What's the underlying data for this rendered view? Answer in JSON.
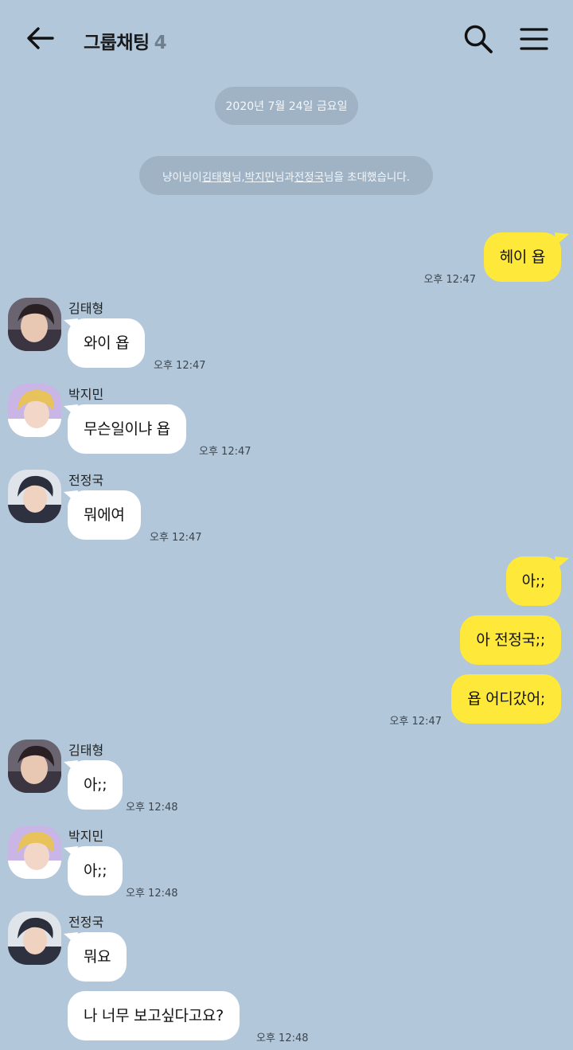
{
  "header": {
    "title": "그룹채팅",
    "member_count": "4",
    "back_icon": "arrow-left-icon",
    "search_icon": "search-icon",
    "menu_icon": "menu-icon"
  },
  "system": {
    "date": "2020년 7월 24일 금요일",
    "invite": {
      "pre": "냥이님이 ",
      "name1": "김태형",
      "mid1": "님, ",
      "name2": "박지민",
      "mid2": "님과 ",
      "name3": "전정국",
      "post": "님을 초대했습니다."
    }
  },
  "colors": {
    "background": "#b2c7da",
    "my_bubble": "#fee93a",
    "other_bubble": "#ffffff",
    "system_pill": "#a0b3c5"
  },
  "messages": [
    {
      "side": "me",
      "text": "헤이 욥",
      "time": "오후 12:47"
    },
    {
      "side": "other",
      "sender": "김태형",
      "text": "와이 욥",
      "time": "오후 12:47"
    },
    {
      "side": "other",
      "sender": "박지민",
      "text": "무슨일이냐 욥",
      "time": "오후 12:47"
    },
    {
      "side": "other",
      "sender": "전정국",
      "text": "뭐에여",
      "time": "오후 12:47"
    },
    {
      "side": "me",
      "text": "아;;",
      "time": ""
    },
    {
      "side": "me",
      "text": "아 전정국;;",
      "time": ""
    },
    {
      "side": "me",
      "text": "욥 어디갔어;",
      "time": "오후 12:47"
    },
    {
      "side": "other",
      "sender": "김태형",
      "text": "아;;",
      "time": "오후 12:48"
    },
    {
      "side": "other",
      "sender": "박지민",
      "text": "아;;",
      "time": "오후 12:48"
    },
    {
      "side": "other",
      "sender": "전정국",
      "text": "뭐요",
      "time": ""
    },
    {
      "side": "other",
      "sender": "",
      "text": "나 너무 보고싶다고요?",
      "time": "오후 12:48"
    }
  ]
}
